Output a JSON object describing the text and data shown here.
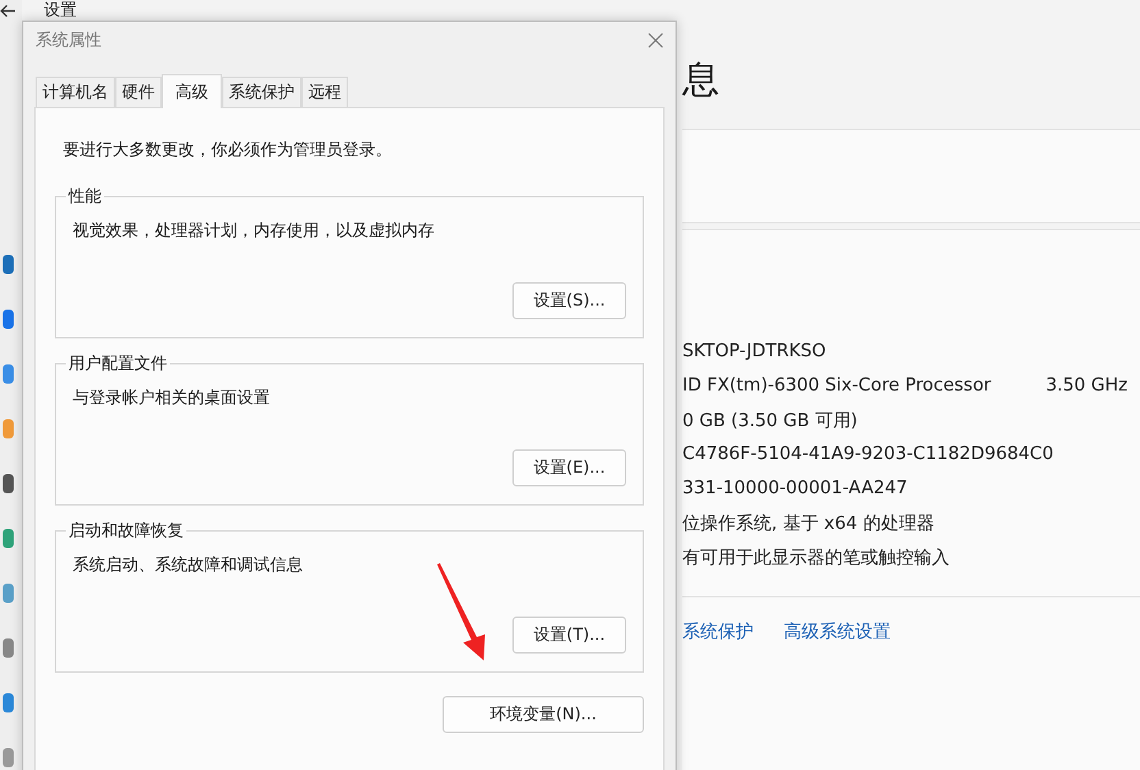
{
  "settings": {
    "title": "设置",
    "heading": "息",
    "specs": [
      {
        "value": "SKTOP-JDTRKSO"
      },
      {
        "value": "ID FX(tm)-6300 Six-Core Processor",
        "extra": "3.50 GHz"
      },
      {
        "value": "0 GB (3.50 GB 可用)"
      },
      {
        "value": "C4786F-5104-41A9-9203-C1182D9684C0"
      },
      {
        "value": "331-10000-00001-AA247"
      },
      {
        "value": "位操作系统, 基于 x64 的处理器"
      },
      {
        "value": "有可用于此显示器的笔或触控输入"
      }
    ],
    "links": [
      "系统保护",
      "高级系统设置"
    ]
  },
  "dialog": {
    "title": "系统属性",
    "tabs": [
      {
        "label": "计算机名",
        "selected": false
      },
      {
        "label": "硬件",
        "selected": false
      },
      {
        "label": "高级",
        "selected": true
      },
      {
        "label": "系统保护",
        "selected": false
      },
      {
        "label": "远程",
        "selected": false
      }
    ],
    "notice": "要进行大多数更改，你必须作为管理员登录。",
    "groups": [
      {
        "title": "性能",
        "description": "视觉效果，处理器计划，内存使用，以及虚拟内存",
        "button": "设置(S)..."
      },
      {
        "title": "用户配置文件",
        "description": "与登录帐户相关的桌面设置",
        "button": "设置(E)..."
      },
      {
        "title": "启动和故障恢复",
        "description": "系统启动、系统故障和调试信息",
        "button": "设置(T)..."
      }
    ],
    "button": "环境变量(N)..."
  }
}
